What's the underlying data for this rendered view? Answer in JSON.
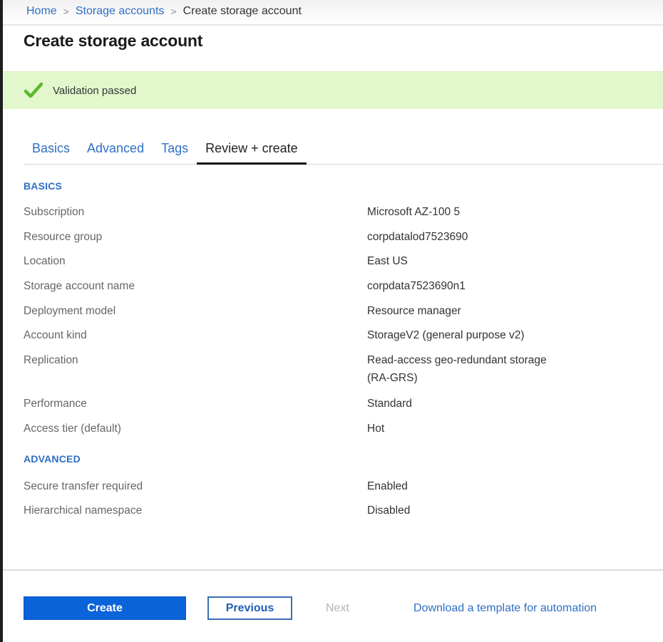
{
  "breadcrumb": {
    "items": [
      "Home",
      "Storage accounts"
    ],
    "current": "Create storage account",
    "separator": ">"
  },
  "page": {
    "title": "Create storage account"
  },
  "validation": {
    "icon": "checkmark-icon",
    "message": "Validation passed",
    "color": "#5cb82e",
    "background": "#e2f8cc"
  },
  "tabs": [
    {
      "label": "Basics",
      "active": false
    },
    {
      "label": "Advanced",
      "active": false
    },
    {
      "label": "Tags",
      "active": false
    },
    {
      "label": "Review + create",
      "active": true
    }
  ],
  "sections": {
    "basics": {
      "title": "BASICS",
      "rows": [
        {
          "label": "Subscription",
          "value": "Microsoft AZ-100 5"
        },
        {
          "label": "Resource group",
          "value": "corpdatalod7523690"
        },
        {
          "label": "Location",
          "value": "East US"
        },
        {
          "label": "Storage account name",
          "value": "corpdata7523690n1"
        },
        {
          "label": "Deployment model",
          "value": "Resource manager"
        },
        {
          "label": "Account kind",
          "value": "StorageV2 (general purpose v2)"
        },
        {
          "label": "Replication",
          "value": "Read-access geo-redundant storage (RA-GRS)"
        },
        {
          "label": "Performance",
          "value": "Standard"
        },
        {
          "label": "Access tier (default)",
          "value": "Hot"
        }
      ]
    },
    "advanced": {
      "title": "ADVANCED",
      "rows": [
        {
          "label": "Secure transfer required",
          "value": "Enabled"
        },
        {
          "label": "Hierarchical namespace",
          "value": "Disabled"
        }
      ]
    }
  },
  "footer": {
    "create_label": "Create",
    "previous_label": "Previous",
    "next_label": "Next",
    "next_disabled": true,
    "download_link": "Download a template for automation"
  },
  "colors": {
    "accent": "#0a63d9",
    "link": "#2f6fc4"
  }
}
